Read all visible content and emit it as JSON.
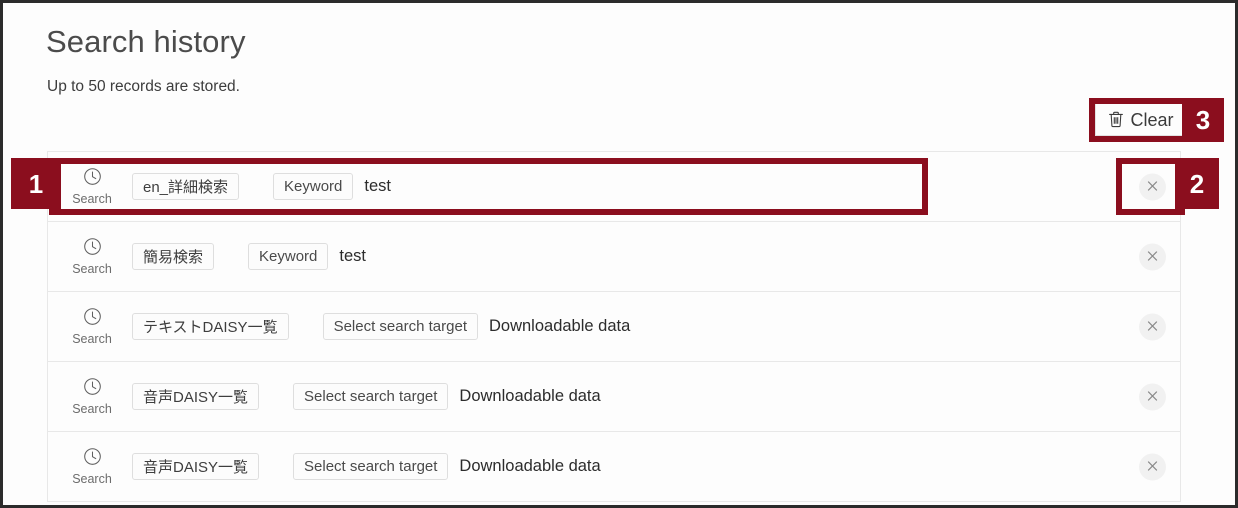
{
  "page": {
    "title": "Search history",
    "subtitle": "Up to 50 records are stored."
  },
  "toolbar": {
    "clear_label": "Clear",
    "clear_icon": "trash-icon"
  },
  "history": {
    "row_icon": "clock-history-icon",
    "row_icon_label": "Search",
    "close_icon": "close-x-icon",
    "rows": [
      {
        "category": "en_詳細検索",
        "field_label": "Keyword",
        "value": "test"
      },
      {
        "category": "簡易検索",
        "field_label": "Keyword",
        "value": "test"
      },
      {
        "category": "テキストDAISY一覧",
        "field_label": "Select search target",
        "value": "Downloadable data"
      },
      {
        "category": "音声DAISY一覧",
        "field_label": "Select search target",
        "value": "Downloadable data"
      },
      {
        "category": "音声DAISY一覧",
        "field_label": "Select search target",
        "value": "Downloadable data"
      }
    ]
  },
  "annotations": {
    "color": "#8b0e1e",
    "markers": [
      {
        "number": "1",
        "target": "first-history-row"
      },
      {
        "number": "2",
        "target": "row-close-button"
      },
      {
        "number": "3",
        "target": "clear-button"
      }
    ]
  }
}
